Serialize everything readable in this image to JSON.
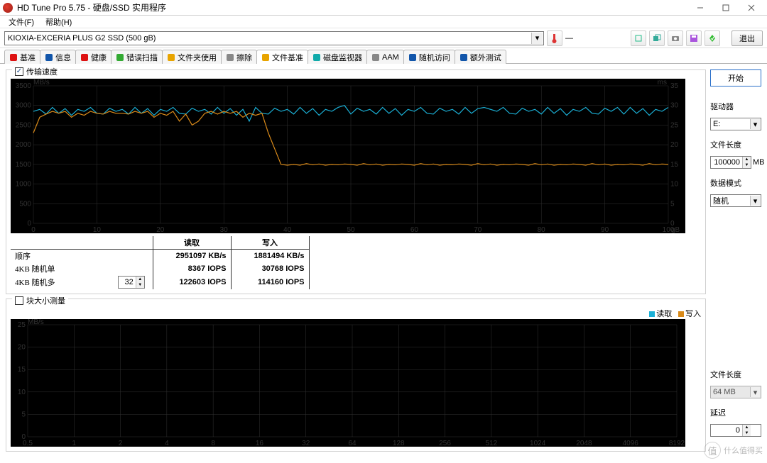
{
  "window": {
    "title": "HD Tune Pro 5.75 - 硬盘/SSD 实用程序"
  },
  "menu": {
    "items": [
      "文件(F)",
      "帮助(H)"
    ]
  },
  "device": {
    "selected": "KIOXIA-EXCERIA PLUS G2 SSD (500 gB)"
  },
  "toolbar": {
    "exit": "退出"
  },
  "tabs": {
    "items": [
      {
        "label": "基准",
        "icon": "#d11"
      },
      {
        "label": "信息",
        "icon": "#15a"
      },
      {
        "label": "健康",
        "icon": "#d11"
      },
      {
        "label": "错误扫描",
        "icon": "#3a3"
      },
      {
        "label": "文件夹使用",
        "icon": "#e8a400"
      },
      {
        "label": "擦除",
        "icon": "#888"
      },
      {
        "label": "文件基准",
        "icon": "#e8a400",
        "active": true
      },
      {
        "label": "磁盘监视器",
        "icon": "#1aa"
      },
      {
        "label": "AAM",
        "icon": "#888"
      },
      {
        "label": "随机访问",
        "icon": "#15a"
      },
      {
        "label": "额外测试",
        "icon": "#15a"
      }
    ]
  },
  "panel1": {
    "checkbox_label": "传输速度",
    "checked": true,
    "y_unit": "MB/s",
    "y2_unit": "ms",
    "x_unit": "gB"
  },
  "panel2": {
    "checkbox_label": "块大小测量",
    "checked": false,
    "y_unit": "MB/s",
    "legend_read": "读取",
    "legend_write": "写入"
  },
  "chart_data": [
    {
      "type": "line",
      "x_range": [
        0,
        100
      ],
      "xticks": [
        0,
        10,
        20,
        30,
        40,
        50,
        60,
        70,
        80,
        90,
        100
      ],
      "y_range": [
        0,
        3500
      ],
      "yticks": [
        0,
        500,
        1000,
        1500,
        2000,
        2500,
        3000,
        3500
      ],
      "y2_range": [
        0,
        35
      ],
      "y2ticks": [
        0,
        5,
        10,
        15,
        20,
        25,
        30,
        35
      ],
      "xlabel": "gB",
      "ylabel": "MB/s",
      "y2label": "ms",
      "series": [
        {
          "name": "读取",
          "color": "#1bb0d6",
          "points": [
            [
              0,
              2850
            ],
            [
              1,
              2900
            ],
            [
              2,
              2780
            ],
            [
              3,
              2950
            ],
            [
              4,
              2800
            ],
            [
              5,
              2920
            ],
            [
              6,
              2750
            ],
            [
              7,
              2900
            ],
            [
              8,
              2850
            ],
            [
              9,
              2950
            ],
            [
              10,
              2800
            ],
            [
              11,
              2780
            ],
            [
              12,
              2930
            ],
            [
              13,
              2850
            ],
            [
              14,
              2900
            ],
            [
              15,
              2780
            ],
            [
              16,
              2950
            ],
            [
              17,
              2800
            ],
            [
              18,
              2920
            ],
            [
              19,
              2750
            ],
            [
              20,
              2900
            ],
            [
              21,
              2850
            ],
            [
              22,
              2950
            ],
            [
              23,
              2800
            ],
            [
              24,
              2780
            ],
            [
              25,
              2930
            ],
            [
              26,
              2850
            ],
            [
              27,
              2900
            ],
            [
              28,
              2780
            ],
            [
              29,
              2950
            ],
            [
              30,
              2800
            ],
            [
              31,
              2920
            ],
            [
              32,
              2750
            ],
            [
              33,
              2900
            ],
            [
              34,
              2600
            ],
            [
              35,
              2950
            ],
            [
              36,
              2800
            ],
            [
              37,
              2780
            ],
            [
              38,
              2930
            ],
            [
              39,
              2850
            ],
            [
              40,
              2900
            ],
            [
              41,
              2780
            ],
            [
              42,
              2950
            ],
            [
              43,
              2800
            ],
            [
              44,
              2920
            ],
            [
              45,
              2750
            ],
            [
              46,
              2900
            ],
            [
              47,
              2850
            ],
            [
              48,
              2950
            ],
            [
              49,
              3000
            ],
            [
              50,
              2780
            ],
            [
              51,
              2930
            ],
            [
              52,
              2850
            ],
            [
              53,
              2900
            ],
            [
              54,
              2780
            ],
            [
              55,
              2950
            ],
            [
              56,
              2800
            ],
            [
              57,
              2920
            ],
            [
              58,
              2750
            ],
            [
              59,
              2900
            ],
            [
              60,
              2850
            ],
            [
              61,
              2950
            ],
            [
              62,
              2800
            ],
            [
              63,
              2780
            ],
            [
              64,
              2930
            ],
            [
              65,
              2850
            ],
            [
              66,
              2900
            ],
            [
              67,
              2780
            ],
            [
              68,
              2950
            ],
            [
              69,
              2800
            ],
            [
              70,
              2920
            ],
            [
              71,
              2950
            ],
            [
              72,
              2900
            ],
            [
              73,
              2850
            ],
            [
              74,
              2950
            ],
            [
              75,
              2800
            ],
            [
              76,
              2780
            ],
            [
              77,
              2930
            ],
            [
              78,
              2850
            ],
            [
              79,
              2900
            ],
            [
              80,
              2780
            ],
            [
              81,
              2950
            ],
            [
              82,
              2800
            ],
            [
              83,
              2920
            ],
            [
              84,
              2750
            ],
            [
              85,
              2900
            ],
            [
              86,
              2850
            ],
            [
              87,
              2950
            ],
            [
              88,
              2800
            ],
            [
              89,
              2780
            ],
            [
              90,
              2930
            ],
            [
              91,
              2850
            ],
            [
              92,
              2950
            ],
            [
              93,
              2780
            ],
            [
              94,
              2950
            ],
            [
              95,
              2800
            ],
            [
              96,
              2920
            ],
            [
              97,
              2750
            ],
            [
              98,
              2900
            ],
            [
              99,
              2850
            ],
            [
              100,
              2950
            ]
          ]
        },
        {
          "name": "写入",
          "color": "#d98a1a",
          "points": [
            [
              0,
              2300
            ],
            [
              1,
              2700
            ],
            [
              2,
              2780
            ],
            [
              3,
              2850
            ],
            [
              4,
              2800
            ],
            [
              5,
              2850
            ],
            [
              6,
              2700
            ],
            [
              7,
              2800
            ],
            [
              8,
              2750
            ],
            [
              9,
              2850
            ],
            [
              10,
              2800
            ],
            [
              11,
              2780
            ],
            [
              12,
              2850
            ],
            [
              13,
              2800
            ],
            [
              14,
              2800
            ],
            [
              15,
              2780
            ],
            [
              16,
              2850
            ],
            [
              17,
              2800
            ],
            [
              18,
              2850
            ],
            [
              19,
              2700
            ],
            [
              20,
              2800
            ],
            [
              21,
              2750
            ],
            [
              22,
              2850
            ],
            [
              23,
              2600
            ],
            [
              24,
              2780
            ],
            [
              25,
              2500
            ],
            [
              26,
              2600
            ],
            [
              27,
              2800
            ],
            [
              28,
              2850
            ],
            [
              29,
              2780
            ],
            [
              30,
              2850
            ],
            [
              31,
              2800
            ],
            [
              32,
              2850
            ],
            [
              33,
              2700
            ],
            [
              34,
              2800
            ],
            [
              35,
              2750
            ],
            [
              36,
              2800
            ],
            [
              37,
              2300
            ],
            [
              38,
              1900
            ],
            [
              39,
              1500
            ],
            [
              40,
              1480
            ],
            [
              41,
              1500
            ],
            [
              42,
              1480
            ],
            [
              43,
              1520
            ],
            [
              44,
              1490
            ],
            [
              45,
              1510
            ],
            [
              46,
              1480
            ],
            [
              47,
              1500
            ],
            [
              48,
              1490
            ],
            [
              49,
              1510
            ],
            [
              50,
              1500
            ],
            [
              51,
              1480
            ],
            [
              52,
              1520
            ],
            [
              53,
              1490
            ],
            [
              54,
              1510
            ],
            [
              55,
              1480
            ],
            [
              56,
              1500
            ],
            [
              57,
              1490
            ],
            [
              58,
              1510
            ],
            [
              59,
              1500
            ],
            [
              60,
              1480
            ],
            [
              61,
              1520
            ],
            [
              62,
              1490
            ],
            [
              63,
              1510
            ],
            [
              64,
              1480
            ],
            [
              65,
              1500
            ],
            [
              66,
              1490
            ],
            [
              67,
              1510
            ],
            [
              68,
              1500
            ],
            [
              69,
              1480
            ],
            [
              70,
              1520
            ],
            [
              71,
              1490
            ],
            [
              72,
              1510
            ],
            [
              73,
              1480
            ],
            [
              74,
              1500
            ],
            [
              75,
              1490
            ],
            [
              76,
              1510
            ],
            [
              77,
              1500
            ],
            [
              78,
              1480
            ],
            [
              79,
              1520
            ],
            [
              80,
              1490
            ],
            [
              81,
              1510
            ],
            [
              82,
              1480
            ],
            [
              83,
              1500
            ],
            [
              84,
              1490
            ],
            [
              85,
              1510
            ],
            [
              86,
              1500
            ],
            [
              87,
              1480
            ],
            [
              88,
              1520
            ],
            [
              89,
              1490
            ],
            [
              90,
              1510
            ],
            [
              91,
              1480
            ],
            [
              92,
              1500
            ],
            [
              93,
              1490
            ],
            [
              94,
              1510
            ],
            [
              95,
              1500
            ],
            [
              96,
              1480
            ],
            [
              97,
              1520
            ],
            [
              98,
              1490
            ],
            [
              99,
              1510
            ],
            [
              100,
              1500
            ]
          ]
        }
      ]
    },
    {
      "type": "line",
      "x_range_log": [
        0.5,
        8192
      ],
      "xticks": [
        0.5,
        1,
        2,
        4,
        8,
        16,
        32,
        64,
        128,
        256,
        512,
        1024,
        2048,
        4096,
        8192
      ],
      "y_range": [
        0,
        25
      ],
      "yticks": [
        0,
        5,
        10,
        15,
        20,
        25
      ],
      "ylabel": "MB/s",
      "series": []
    }
  ],
  "results": {
    "cols": [
      "读取",
      "写入"
    ],
    "rows": [
      {
        "label": "顺序",
        "read": "2951097 KB/s",
        "write": "1881494 KB/s"
      },
      {
        "label": "4KB 随机单",
        "read": "8367 IOPS",
        "write": "30768 IOPS"
      },
      {
        "label": "4KB 随机多",
        "qd": "32",
        "read": "122603 IOPS",
        "write": "114160 IOPS"
      }
    ]
  },
  "side": {
    "start": "开始",
    "drive_label": "驱动器",
    "drive_value": "E:",
    "filelen_label": "文件长度",
    "filelen_value": "100000",
    "filelen_unit": "MB",
    "datapat_label": "数据模式",
    "datapat_value": "随机",
    "filelen2_label": "文件长度",
    "filelen2_value": "64 MB",
    "delay_label": "延迟",
    "delay_value": "0"
  },
  "watermark": "什么值得买"
}
